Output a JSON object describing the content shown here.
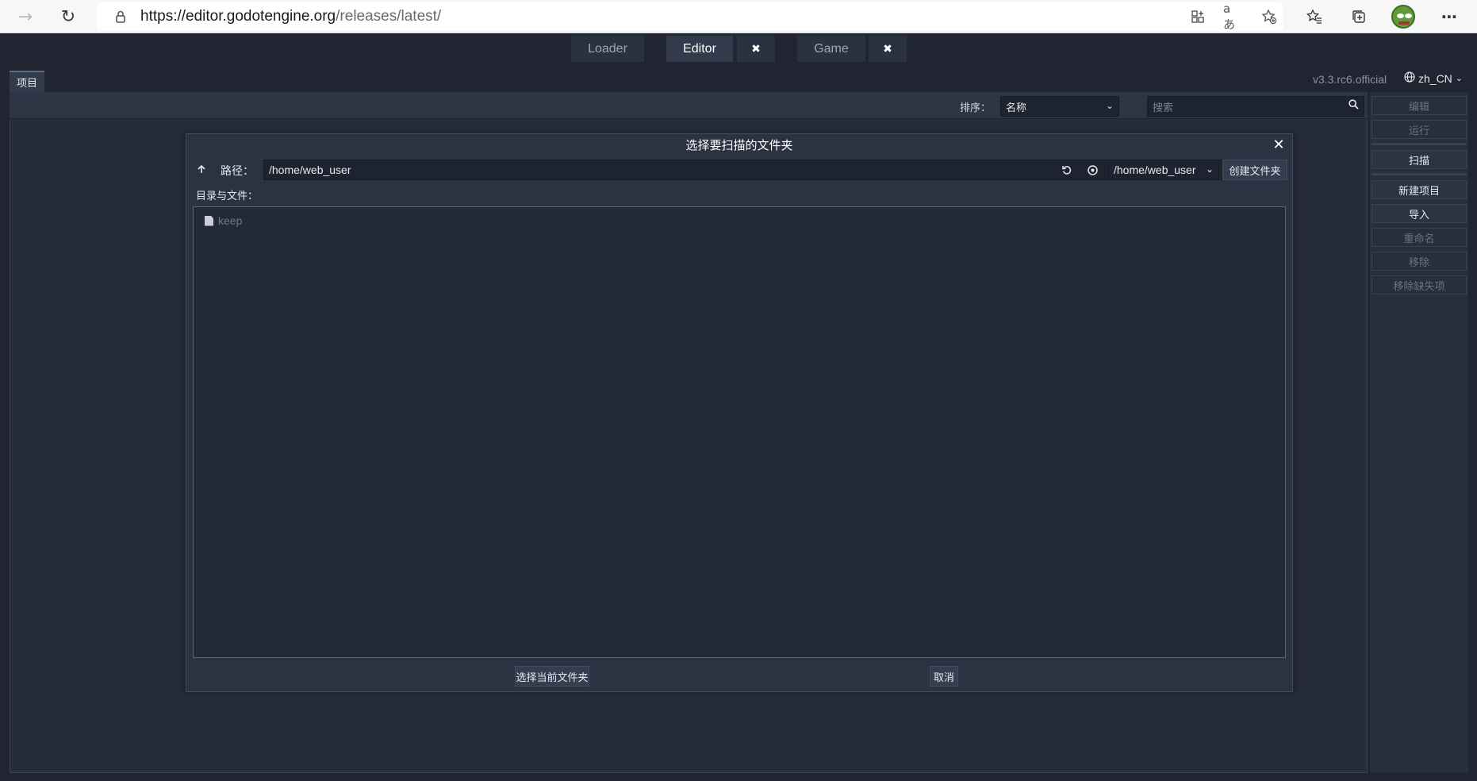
{
  "browser": {
    "url_host": "https://editor.godotengine.org",
    "url_path": "/releases/latest/"
  },
  "top_tabs": [
    {
      "label": "Loader"
    },
    {
      "label": "Editor"
    },
    {
      "label": "Game"
    }
  ],
  "top_close_glyph": "✖",
  "project_manager": {
    "tab_label": "项目",
    "version": "v3.3.rc6.official",
    "language": "zh_CN",
    "sort_label": "排序：",
    "sort_value": "名称",
    "search_placeholder": "搜索"
  },
  "sidebar": {
    "buttons": [
      {
        "label": "编辑",
        "enabled": false
      },
      {
        "label": "运行",
        "enabled": false
      },
      {
        "label": "扫描",
        "enabled": true
      },
      {
        "label": "新建项目",
        "enabled": true
      },
      {
        "label": "导入",
        "enabled": true
      },
      {
        "label": "重命名",
        "enabled": false
      },
      {
        "label": "移除",
        "enabled": false
      },
      {
        "label": "移除缺失项",
        "enabled": false
      }
    ]
  },
  "dialog": {
    "title": "选择要扫描的文件夹",
    "path_label": "路径：",
    "path_value": "/home/web_user",
    "drive_value": "/home/web_user",
    "mkdir_label": "创建文件夹",
    "files_label": "目录与文件：",
    "files": [
      {
        "name": "keep",
        "icon": "file-icon"
      }
    ],
    "select_current_label": "选择当前文件夹",
    "cancel_label": "取消"
  },
  "colors": {
    "background": "#202531",
    "panel": "#272e3c",
    "dialog": "#2b3242",
    "input": "#1e2330",
    "text": "#e6e9ef",
    "disabled_text": "#6b7282"
  }
}
